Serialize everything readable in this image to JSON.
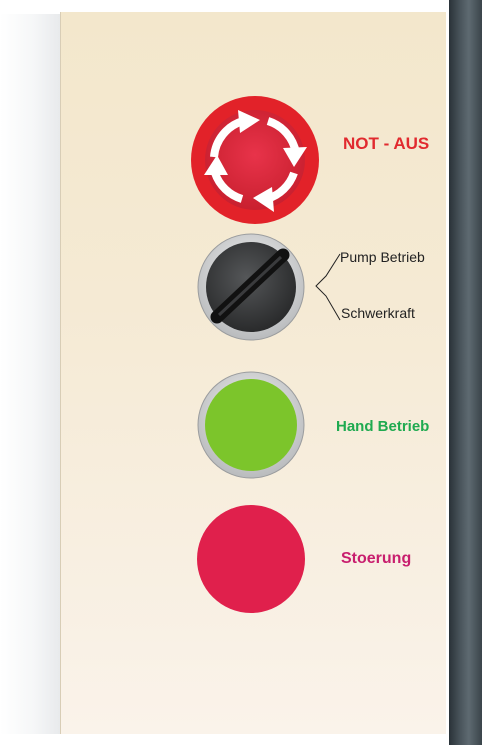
{
  "panel": {
    "emergency_stop": {
      "label": "NOT - AUS",
      "color": "#e12a2f"
    },
    "selector_switch": {
      "options": [
        "Pump Betrieb",
        "Schwerkraft"
      ],
      "color": "#333333"
    },
    "hand_mode": {
      "label": "Hand Betrieb",
      "indicator_color": "#7cc52b",
      "label_color": "#1faa50"
    },
    "fault": {
      "label": "Stoerung",
      "indicator_color": "#e0204c",
      "label_color": "#c81e6e"
    }
  },
  "icons": [
    "emergency-stop-icon",
    "rotary-selector-icon",
    "green-indicator-lamp-icon",
    "red-indicator-lamp-icon"
  ]
}
